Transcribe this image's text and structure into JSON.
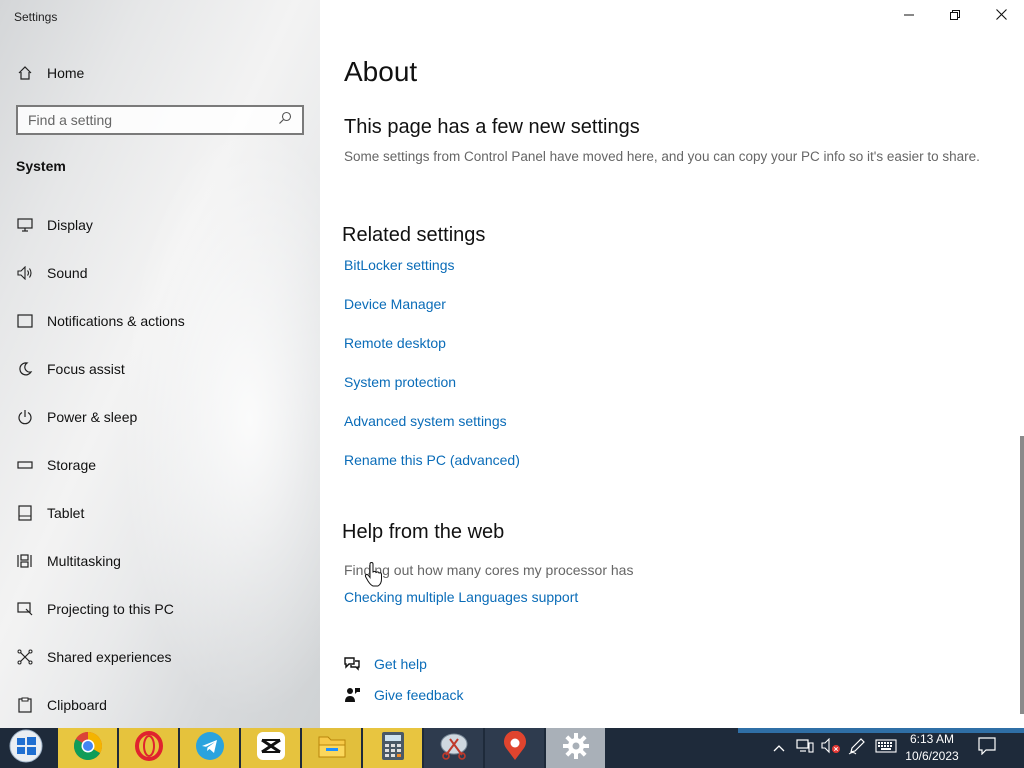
{
  "window": {
    "title": "Settings"
  },
  "sidebar": {
    "home_label": "Home",
    "search_placeholder": "Find a setting",
    "section_title": "System",
    "items": [
      {
        "label": "Display",
        "icon": "monitor-icon"
      },
      {
        "label": "Sound",
        "icon": "speaker-icon"
      },
      {
        "label": "Notifications & actions",
        "icon": "notification-icon"
      },
      {
        "label": "Focus assist",
        "icon": "moon-icon"
      },
      {
        "label": "Power & sleep",
        "icon": "power-icon"
      },
      {
        "label": "Storage",
        "icon": "storage-icon"
      },
      {
        "label": "Tablet",
        "icon": "tablet-icon"
      },
      {
        "label": "Multitasking",
        "icon": "multitasking-icon"
      },
      {
        "label": "Projecting to this PC",
        "icon": "projector-icon"
      },
      {
        "label": "Shared experiences",
        "icon": "share-icon"
      },
      {
        "label": "Clipboard",
        "icon": "clipboard-icon"
      }
    ]
  },
  "main": {
    "title": "About",
    "new_settings": {
      "heading": "This page has a few new settings",
      "description": "Some settings from Control Panel have moved here, and you can copy your PC info so it's easier to share."
    },
    "related": {
      "heading": "Related settings",
      "links": [
        "BitLocker settings",
        "Device Manager",
        "Remote desktop",
        "System protection",
        "Advanced system settings",
        "Rename this PC (advanced)"
      ]
    },
    "help_web": {
      "heading": "Help from the web",
      "items": [
        "Finding out how many cores my processor has",
        "Checking multiple Languages support"
      ]
    },
    "get_help_label": "Get help",
    "give_feedback_label": "Give feedback"
  },
  "taskbar": {
    "apps": [
      "chrome",
      "opera",
      "telegram",
      "capcut",
      "file-explorer",
      "calculator",
      "snipping-tool",
      "maps",
      "settings"
    ],
    "time": "6:13 AM",
    "date": "10/6/2023"
  },
  "colors": {
    "link": "#0a6cb8",
    "taskbar": "#1e2a3a",
    "accent_strip": "#2f6fa6"
  }
}
